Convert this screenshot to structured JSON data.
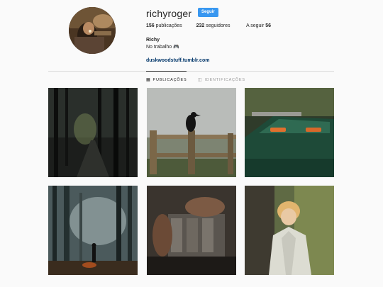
{
  "profile": {
    "username": "richyroger",
    "follow_label": "Seguir",
    "full_name": "Richy",
    "bio": "No trabalho 🎮",
    "website": "duskwoodstuff.tumblr.com"
  },
  "stats": {
    "posts_count": "156",
    "posts_label": "publicações",
    "followers_count": "232",
    "followers_label": "seguidores",
    "following_label": "A seguir",
    "following_count": "56"
  },
  "tabs": [
    {
      "label": "PUBLICAÇÕES",
      "icon": "grid-icon",
      "active": true
    },
    {
      "label": "IDENTIFICAÇÕES",
      "icon": "tag-icon",
      "active": false
    }
  ],
  "colors": {
    "accent": "#3897f0",
    "link": "#003569",
    "background": "#fafafa"
  },
  "posts": [
    {
      "subject": "dark-forest-road"
    },
    {
      "subject": "crow-on-fence"
    },
    {
      "subject": "green-vintage-car"
    },
    {
      "subject": "figure-in-foggy-forest"
    },
    {
      "subject": "hands-on-engine"
    },
    {
      "subject": "blond-man-by-tree"
    }
  ]
}
